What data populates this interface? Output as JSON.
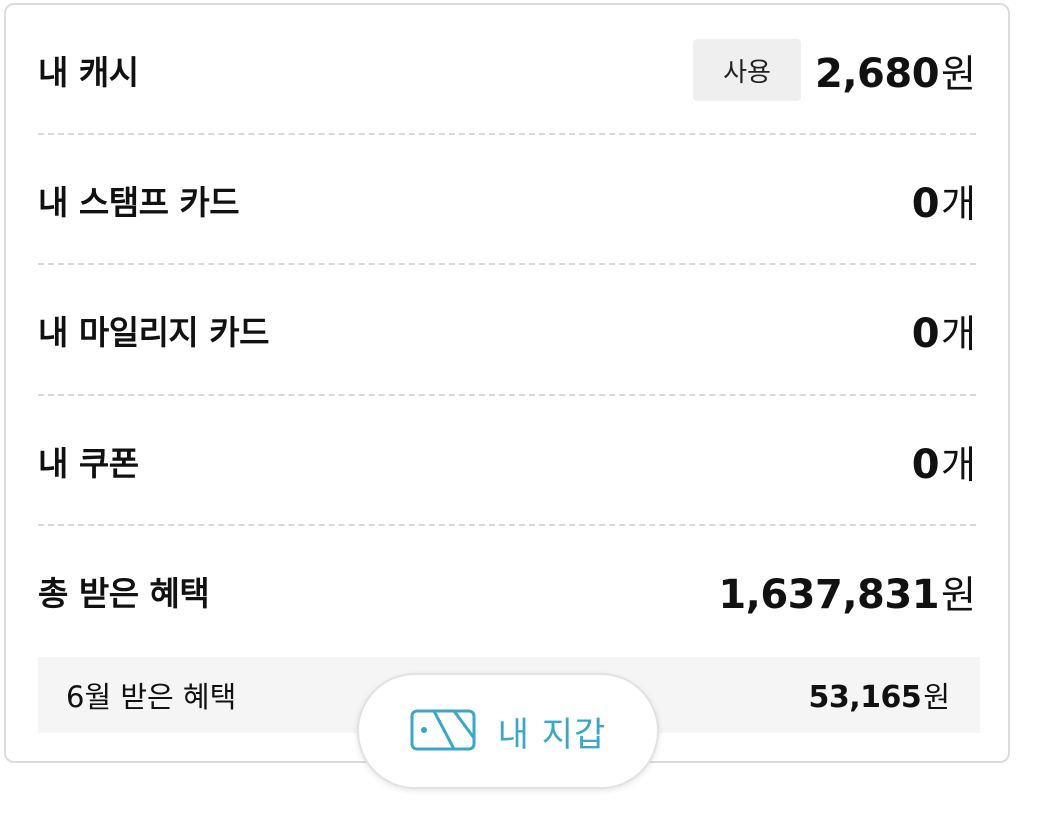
{
  "rows": [
    {
      "label": "내 캐시",
      "value": "2,680",
      "unit": "원",
      "action_label": "사용"
    },
    {
      "label": "내 스탬프 카드",
      "value": "0",
      "unit": "개"
    },
    {
      "label": "내 마일리지 카드",
      "value": "0",
      "unit": "개"
    },
    {
      "label": "내 쿠폰",
      "value": "0",
      "unit": "개"
    },
    {
      "label": "총 받은 혜택",
      "value": "1,637,831",
      "unit": "원"
    }
  ],
  "monthly": {
    "label": "6월 받은 혜택",
    "value": "53,165",
    "unit": "원"
  },
  "wallet_button": {
    "label": "내 지갑",
    "icon": "wallet-icon"
  },
  "colors": {
    "accent": "#3aa7c6",
    "button_bg": "#efefef",
    "sub_row_bg": "#f5f5f5",
    "divider": "#d9d9d9"
  }
}
